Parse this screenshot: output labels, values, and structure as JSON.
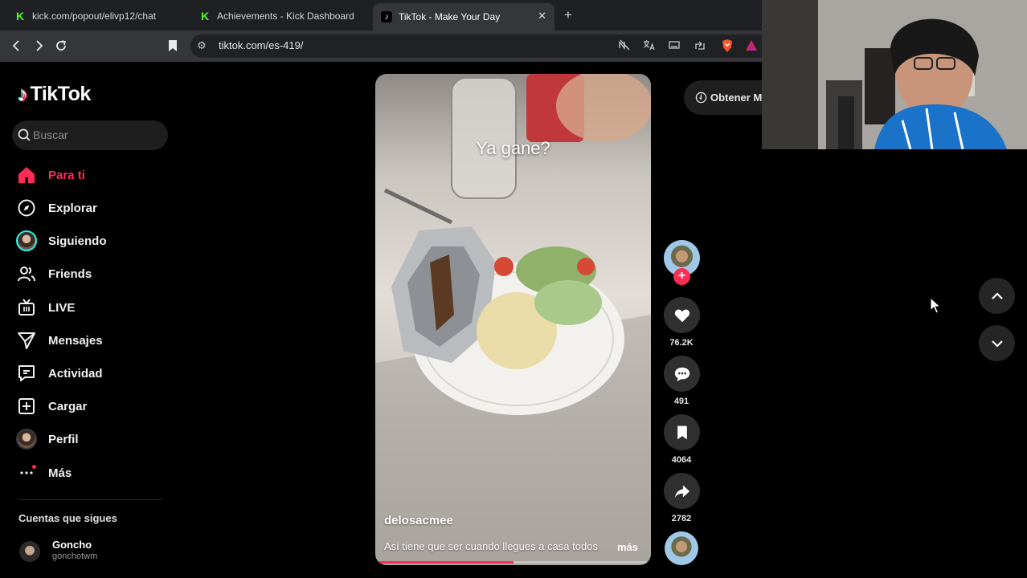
{
  "browser": {
    "tabs": [
      {
        "title": "kick.com/popout/elivp12/chat",
        "favicon": "kick-icon",
        "active": false
      },
      {
        "title": "Achievements - Kick Dashboard",
        "favicon": "kick-icon",
        "active": false
      },
      {
        "title": "TikTok - Make Your Day",
        "favicon": "tiktok-icon",
        "active": true
      }
    ],
    "url": "tiktok.com/es-419/"
  },
  "sidebar": {
    "logo_text": "TikTok",
    "search_placeholder": "Buscar",
    "nav": [
      {
        "label": "Para ti",
        "icon": "home-icon",
        "active": true
      },
      {
        "label": "Explorar",
        "icon": "compass-icon",
        "active": false
      },
      {
        "label": "Siguiendo",
        "icon": "following-avatar-icon",
        "active": false
      },
      {
        "label": "Friends",
        "icon": "friends-icon",
        "active": false
      },
      {
        "label": "LIVE",
        "icon": "live-tv-icon",
        "active": false
      },
      {
        "label": "Mensajes",
        "icon": "messages-icon",
        "active": false
      },
      {
        "label": "Actividad",
        "icon": "activity-icon",
        "active": false
      },
      {
        "label": "Cargar",
        "icon": "upload-icon",
        "active": false
      },
      {
        "label": "Perfil",
        "icon": "profile-avatar-icon",
        "active": false
      },
      {
        "label": "Más",
        "icon": "more-icon",
        "active": false
      }
    ],
    "following_title": "Cuentas que sigues",
    "following": [
      {
        "name": "Goncho",
        "handle": "gonchotwm"
      }
    ]
  },
  "video": {
    "overlay_text": "Ya gane?",
    "username": "delosacmee",
    "caption": "Así tiene que ser cuando llegues a casa todos",
    "more_label": "más",
    "progress": 0.5
  },
  "actions": {
    "likes": "76.2K",
    "comments": "491",
    "saves": "4064",
    "shares": "2782"
  },
  "get_app_label": "Obtener M",
  "colors": {
    "accent": "#fe2c55",
    "background": "#000000"
  }
}
